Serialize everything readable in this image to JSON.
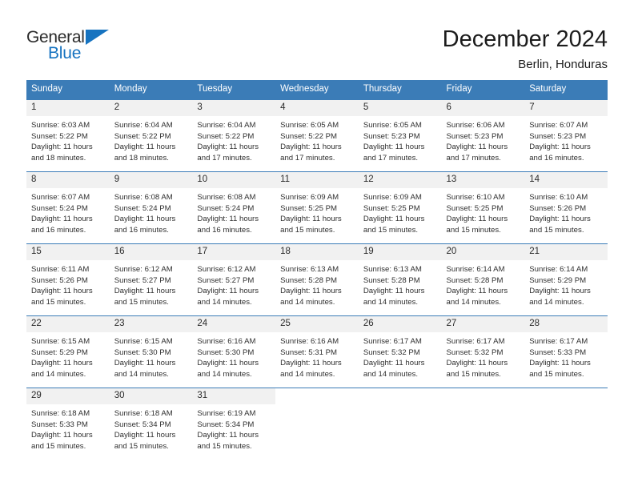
{
  "brand": {
    "name_part1": "General",
    "name_part2": "Blue",
    "triangle_color": "#1673c0"
  },
  "header": {
    "title": "December 2024",
    "subtitle": "Berlin, Honduras"
  },
  "theme": {
    "header_bg": "#3b7cb7",
    "header_text": "#ffffff",
    "daynum_bg": "#f1f1f1",
    "grid_line": "#3b7cb7",
    "body_text": "#303030"
  },
  "weekdays": [
    "Sunday",
    "Monday",
    "Tuesday",
    "Wednesday",
    "Thursday",
    "Friday",
    "Saturday"
  ],
  "weeks": [
    [
      {
        "day": "1",
        "sunrise": "Sunrise: 6:03 AM",
        "sunset": "Sunset: 5:22 PM",
        "daylight_line1": "Daylight: 11 hours",
        "daylight_line2": "and 18 minutes."
      },
      {
        "day": "2",
        "sunrise": "Sunrise: 6:04 AM",
        "sunset": "Sunset: 5:22 PM",
        "daylight_line1": "Daylight: 11 hours",
        "daylight_line2": "and 18 minutes."
      },
      {
        "day": "3",
        "sunrise": "Sunrise: 6:04 AM",
        "sunset": "Sunset: 5:22 PM",
        "daylight_line1": "Daylight: 11 hours",
        "daylight_line2": "and 17 minutes."
      },
      {
        "day": "4",
        "sunrise": "Sunrise: 6:05 AM",
        "sunset": "Sunset: 5:22 PM",
        "daylight_line1": "Daylight: 11 hours",
        "daylight_line2": "and 17 minutes."
      },
      {
        "day": "5",
        "sunrise": "Sunrise: 6:05 AM",
        "sunset": "Sunset: 5:23 PM",
        "daylight_line1": "Daylight: 11 hours",
        "daylight_line2": "and 17 minutes."
      },
      {
        "day": "6",
        "sunrise": "Sunrise: 6:06 AM",
        "sunset": "Sunset: 5:23 PM",
        "daylight_line1": "Daylight: 11 hours",
        "daylight_line2": "and 17 minutes."
      },
      {
        "day": "7",
        "sunrise": "Sunrise: 6:07 AM",
        "sunset": "Sunset: 5:23 PM",
        "daylight_line1": "Daylight: 11 hours",
        "daylight_line2": "and 16 minutes."
      }
    ],
    [
      {
        "day": "8",
        "sunrise": "Sunrise: 6:07 AM",
        "sunset": "Sunset: 5:24 PM",
        "daylight_line1": "Daylight: 11 hours",
        "daylight_line2": "and 16 minutes."
      },
      {
        "day": "9",
        "sunrise": "Sunrise: 6:08 AM",
        "sunset": "Sunset: 5:24 PM",
        "daylight_line1": "Daylight: 11 hours",
        "daylight_line2": "and 16 minutes."
      },
      {
        "day": "10",
        "sunrise": "Sunrise: 6:08 AM",
        "sunset": "Sunset: 5:24 PM",
        "daylight_line1": "Daylight: 11 hours",
        "daylight_line2": "and 16 minutes."
      },
      {
        "day": "11",
        "sunrise": "Sunrise: 6:09 AM",
        "sunset": "Sunset: 5:25 PM",
        "daylight_line1": "Daylight: 11 hours",
        "daylight_line2": "and 15 minutes."
      },
      {
        "day": "12",
        "sunrise": "Sunrise: 6:09 AM",
        "sunset": "Sunset: 5:25 PM",
        "daylight_line1": "Daylight: 11 hours",
        "daylight_line2": "and 15 minutes."
      },
      {
        "day": "13",
        "sunrise": "Sunrise: 6:10 AM",
        "sunset": "Sunset: 5:25 PM",
        "daylight_line1": "Daylight: 11 hours",
        "daylight_line2": "and 15 minutes."
      },
      {
        "day": "14",
        "sunrise": "Sunrise: 6:10 AM",
        "sunset": "Sunset: 5:26 PM",
        "daylight_line1": "Daylight: 11 hours",
        "daylight_line2": "and 15 minutes."
      }
    ],
    [
      {
        "day": "15",
        "sunrise": "Sunrise: 6:11 AM",
        "sunset": "Sunset: 5:26 PM",
        "daylight_line1": "Daylight: 11 hours",
        "daylight_line2": "and 15 minutes."
      },
      {
        "day": "16",
        "sunrise": "Sunrise: 6:12 AM",
        "sunset": "Sunset: 5:27 PM",
        "daylight_line1": "Daylight: 11 hours",
        "daylight_line2": "and 15 minutes."
      },
      {
        "day": "17",
        "sunrise": "Sunrise: 6:12 AM",
        "sunset": "Sunset: 5:27 PM",
        "daylight_line1": "Daylight: 11 hours",
        "daylight_line2": "and 14 minutes."
      },
      {
        "day": "18",
        "sunrise": "Sunrise: 6:13 AM",
        "sunset": "Sunset: 5:28 PM",
        "daylight_line1": "Daylight: 11 hours",
        "daylight_line2": "and 14 minutes."
      },
      {
        "day": "19",
        "sunrise": "Sunrise: 6:13 AM",
        "sunset": "Sunset: 5:28 PM",
        "daylight_line1": "Daylight: 11 hours",
        "daylight_line2": "and 14 minutes."
      },
      {
        "day": "20",
        "sunrise": "Sunrise: 6:14 AM",
        "sunset": "Sunset: 5:28 PM",
        "daylight_line1": "Daylight: 11 hours",
        "daylight_line2": "and 14 minutes."
      },
      {
        "day": "21",
        "sunrise": "Sunrise: 6:14 AM",
        "sunset": "Sunset: 5:29 PM",
        "daylight_line1": "Daylight: 11 hours",
        "daylight_line2": "and 14 minutes."
      }
    ],
    [
      {
        "day": "22",
        "sunrise": "Sunrise: 6:15 AM",
        "sunset": "Sunset: 5:29 PM",
        "daylight_line1": "Daylight: 11 hours",
        "daylight_line2": "and 14 minutes."
      },
      {
        "day": "23",
        "sunrise": "Sunrise: 6:15 AM",
        "sunset": "Sunset: 5:30 PM",
        "daylight_line1": "Daylight: 11 hours",
        "daylight_line2": "and 14 minutes."
      },
      {
        "day": "24",
        "sunrise": "Sunrise: 6:16 AM",
        "sunset": "Sunset: 5:30 PM",
        "daylight_line1": "Daylight: 11 hours",
        "daylight_line2": "and 14 minutes."
      },
      {
        "day": "25",
        "sunrise": "Sunrise: 6:16 AM",
        "sunset": "Sunset: 5:31 PM",
        "daylight_line1": "Daylight: 11 hours",
        "daylight_line2": "and 14 minutes."
      },
      {
        "day": "26",
        "sunrise": "Sunrise: 6:17 AM",
        "sunset": "Sunset: 5:32 PM",
        "daylight_line1": "Daylight: 11 hours",
        "daylight_line2": "and 14 minutes."
      },
      {
        "day": "27",
        "sunrise": "Sunrise: 6:17 AM",
        "sunset": "Sunset: 5:32 PM",
        "daylight_line1": "Daylight: 11 hours",
        "daylight_line2": "and 15 minutes."
      },
      {
        "day": "28",
        "sunrise": "Sunrise: 6:17 AM",
        "sunset": "Sunset: 5:33 PM",
        "daylight_line1": "Daylight: 11 hours",
        "daylight_line2": "and 15 minutes."
      }
    ],
    [
      {
        "day": "29",
        "sunrise": "Sunrise: 6:18 AM",
        "sunset": "Sunset: 5:33 PM",
        "daylight_line1": "Daylight: 11 hours",
        "daylight_line2": "and 15 minutes."
      },
      {
        "day": "30",
        "sunrise": "Sunrise: 6:18 AM",
        "sunset": "Sunset: 5:34 PM",
        "daylight_line1": "Daylight: 11 hours",
        "daylight_line2": "and 15 minutes."
      },
      {
        "day": "31",
        "sunrise": "Sunrise: 6:19 AM",
        "sunset": "Sunset: 5:34 PM",
        "daylight_line1": "Daylight: 11 hours",
        "daylight_line2": "and 15 minutes."
      },
      {
        "day": "",
        "sunrise": "",
        "sunset": "",
        "daylight_line1": "",
        "daylight_line2": ""
      },
      {
        "day": "",
        "sunrise": "",
        "sunset": "",
        "daylight_line1": "",
        "daylight_line2": ""
      },
      {
        "day": "",
        "sunrise": "",
        "sunset": "",
        "daylight_line1": "",
        "daylight_line2": ""
      },
      {
        "day": "",
        "sunrise": "",
        "sunset": "",
        "daylight_line1": "",
        "daylight_line2": ""
      }
    ]
  ]
}
